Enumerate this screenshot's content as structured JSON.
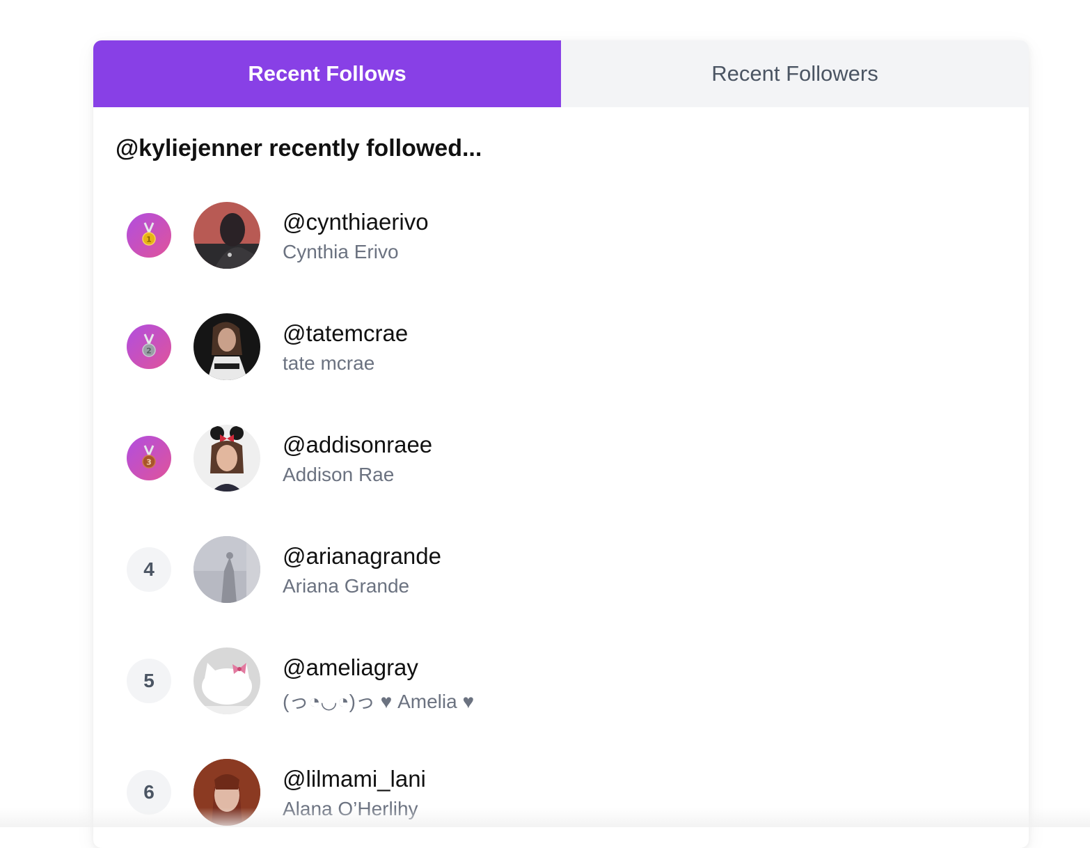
{
  "tabs": [
    {
      "label": "Recent Follows",
      "active": true
    },
    {
      "label": "Recent Followers",
      "active": false
    }
  ],
  "heading": "@kyliejenner recently followed...",
  "colors": {
    "active_tab": "#8840e6",
    "inactive_tab": "#f3f4f6",
    "medal_gradient_start": "#b04ee0",
    "medal_gradient_end": "#e0539a",
    "gold": "#e7b416",
    "silver": "#9aa0a6",
    "bronze": "#a8552a"
  },
  "follows": [
    {
      "rank": "1",
      "medal": "gold-medal-icon",
      "handle": "@cynthiaerivo",
      "name": "Cynthia Erivo"
    },
    {
      "rank": "2",
      "medal": "silver-medal-icon",
      "handle": "@tatemcrae",
      "name": "tate mcrae"
    },
    {
      "rank": "3",
      "medal": "bronze-medal-icon",
      "handle": "@addisonraee",
      "name": "Addison Rae"
    },
    {
      "rank": "4",
      "medal": null,
      "handle": "@arianagrande",
      "name": "Ariana Grande"
    },
    {
      "rank": "5",
      "medal": null,
      "handle": "@ameliagray",
      "name": "(っ◔◡◔)っ ♥ Amelia ♥"
    },
    {
      "rank": "6",
      "medal": null,
      "handle": "@lilmami_lani",
      "name": "Alana O’Herlihy"
    }
  ]
}
